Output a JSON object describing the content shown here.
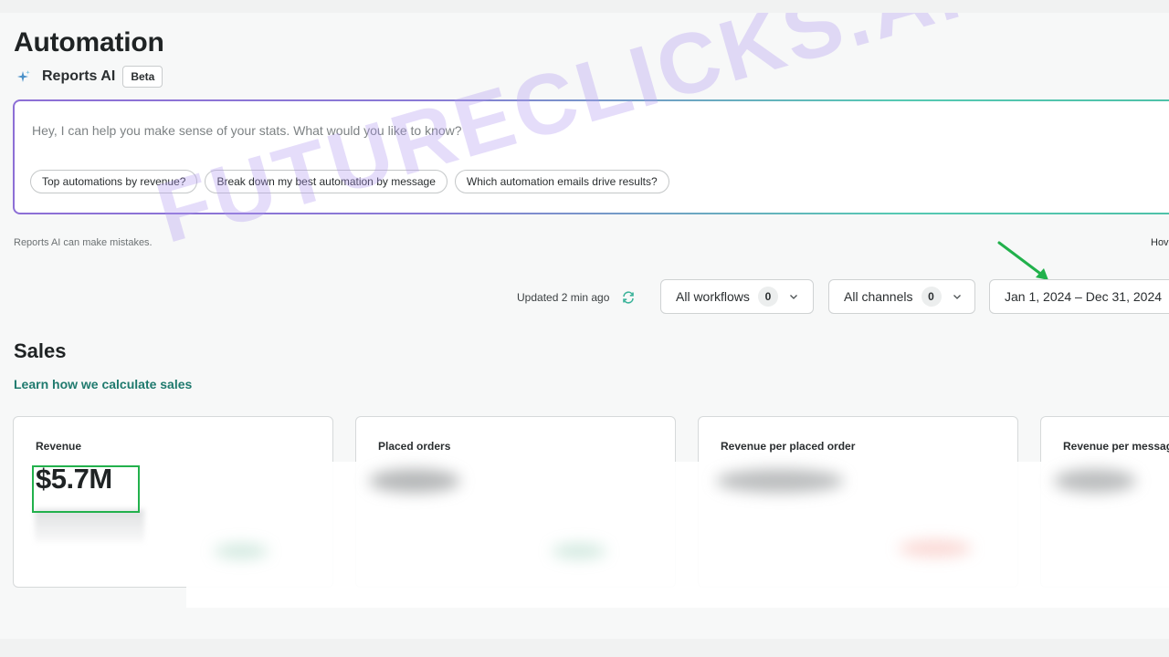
{
  "header": {
    "title": "Automation"
  },
  "reports_ai": {
    "label": "Reports AI",
    "badge": "Beta",
    "prompt_placeholder": "Hey, I can help you make sense of your stats. What would you like to know?",
    "suggestions": [
      "Top automations by revenue?",
      "Break down my best automation by message",
      "Which automation emails drive results?"
    ],
    "disclaimer": "Reports AI can make mistakes.",
    "how_link": "Hov"
  },
  "toolbar": {
    "updated_text": "Updated 2 min ago",
    "filters": {
      "workflows": {
        "label": "All workflows",
        "count": "0"
      },
      "channels": {
        "label": "All channels",
        "count": "0"
      },
      "date_range": {
        "label": "Jan 1, 2024 – Dec 31, 2024"
      }
    }
  },
  "sales": {
    "title": "Sales",
    "learn_link": "Learn how we calculate sales",
    "cards": [
      {
        "label": "Revenue",
        "value": "$5.7M"
      },
      {
        "label": "Placed orders"
      },
      {
        "label": "Revenue per placed order"
      },
      {
        "label": "Revenue per message"
      }
    ]
  },
  "watermark": "FUTURECLICKS.AI",
  "colors": {
    "accent_teal": "#1f7a6e",
    "highlight_green": "#22b14c",
    "gradient_start": "#8d6fd6",
    "gradient_end": "#4ec1a8",
    "watermark": "#af96f0"
  },
  "icons": {
    "reports_ai": "sparkle-icon",
    "refresh": "refresh-icon",
    "dropdown": "chevron-down-icon",
    "annotation": "arrow-icon"
  }
}
